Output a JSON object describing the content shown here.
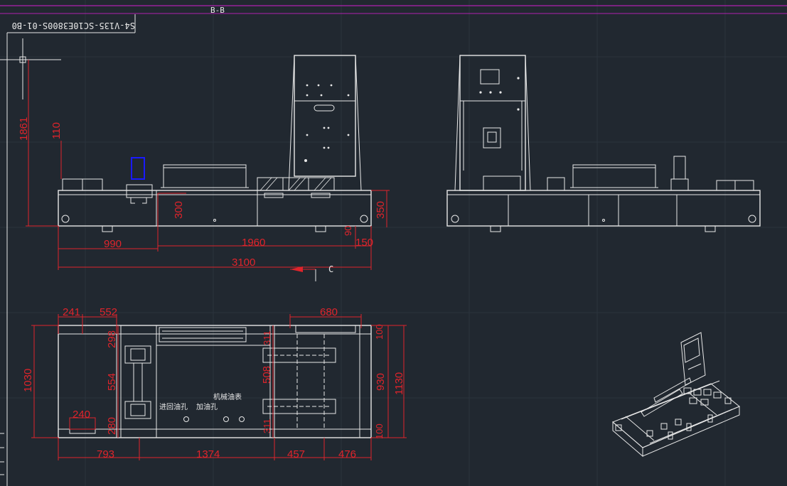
{
  "drawing": {
    "section_label": "B-B",
    "drawing_number": "S4-V135-SC10E3800S-01-B0",
    "view_arrow_label": "C"
  },
  "front_view_dims": {
    "total_height": "1861",
    "top_offset": "110",
    "base_height": "300",
    "right_height": "350",
    "left_span": "990",
    "mid_span": "1960",
    "right_step": "150",
    "small_gap": "90",
    "total_width": "3100"
  },
  "plan_view_dims": {
    "top_a": "241",
    "top_b": "552",
    "top_c": "680",
    "left_total": "1030",
    "upper_slot": "298",
    "mid_slot": "554",
    "lower_slot": "280",
    "bottom_tab": "240",
    "right_slot_top": "311",
    "right_slot_mid": "508",
    "right_slot_bot": "311",
    "right_top": "100",
    "right_mid": "930",
    "right_total": "1130",
    "right_bot": "100",
    "bottom_a": "793",
    "bottom_b": "1374",
    "bottom_c": "457",
    "bottom_d": "476"
  },
  "plan_view_notes": {
    "note_1": "进回油孔",
    "note_2": "加油孔",
    "note_3": "机械油表"
  },
  "colors": {
    "background": "#212830",
    "line": "#e8e8e8",
    "dimension": "#e0242b",
    "highlight": "#1a1aff",
    "frame": "#b020b0"
  }
}
